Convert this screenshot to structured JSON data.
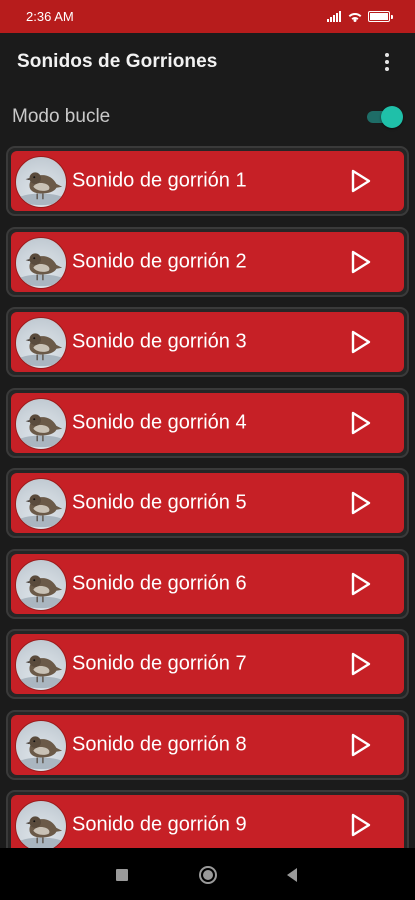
{
  "status_bar": {
    "time": "2:36 AM",
    "icons": [
      "signal-icon",
      "wifi-icon",
      "battery-icon"
    ]
  },
  "app_bar": {
    "title": "Sonidos de Gorriones",
    "menu_icon": "more-vert-icon"
  },
  "loop_mode": {
    "label": "Modo bucle",
    "enabled": true
  },
  "sounds": [
    {
      "label": "Sonido de gorrión 1",
      "image": "sparrow-thumbnail",
      "action_icon": "play-icon"
    },
    {
      "label": "Sonido de gorrión 2",
      "image": "sparrow-thumbnail",
      "action_icon": "play-icon"
    },
    {
      "label": "Sonido de gorrión 3",
      "image": "sparrow-thumbnail",
      "action_icon": "play-icon"
    },
    {
      "label": "Sonido de gorrión 4",
      "image": "sparrow-thumbnail",
      "action_icon": "play-icon"
    },
    {
      "label": "Sonido de gorrión 5",
      "image": "sparrow-thumbnail",
      "action_icon": "play-icon"
    },
    {
      "label": "Sonido de gorrión 6",
      "image": "sparrow-thumbnail",
      "action_icon": "play-icon"
    },
    {
      "label": "Sonido de gorrión 7",
      "image": "sparrow-thumbnail",
      "action_icon": "play-icon"
    },
    {
      "label": "Sonido de gorrión 8",
      "image": "sparrow-thumbnail",
      "action_icon": "play-icon"
    },
    {
      "label": "Sonido de gorrión 9",
      "image": "sparrow-thumbnail",
      "action_icon": "play-icon"
    }
  ],
  "nav_bar": {
    "buttons": [
      "recent-apps-icon",
      "home-icon",
      "back-icon"
    ]
  },
  "colors": {
    "primary_red": "#c62026",
    "status_bar_red": "#b71c1c",
    "background": "#1b1b1b",
    "switch_accent": "#1fc0a9"
  }
}
